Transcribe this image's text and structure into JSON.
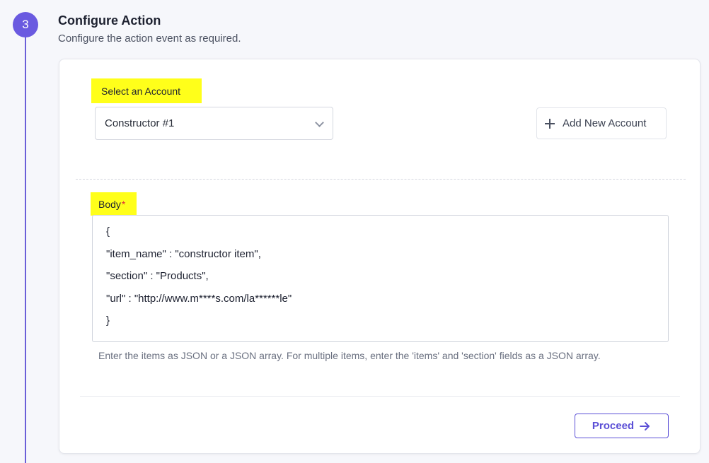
{
  "step": {
    "number": "3",
    "title": "Configure Action",
    "subtitle": "Configure the action event as required."
  },
  "account": {
    "label": "Select an Account",
    "selected": "Constructor #1",
    "add_button_label": "Add New Account"
  },
  "body": {
    "label": "Body",
    "required_marker": "*",
    "lines": [
      "{",
      "\"item_name\" : \"constructor item\",",
      "\"section\" : \"Products\",",
      "\"url\" : \"http://www.m****s.com/la******le\"",
      "}"
    ],
    "help_text": "Enter the items as JSON or a JSON array. For multiple items, enter the 'items' and 'section' fields as a JSON array."
  },
  "actions": {
    "proceed_label": "Proceed"
  },
  "icons": {
    "dropdown": "chevron-down-icon",
    "add": "plus-icon",
    "proceed": "arrow-right-icon"
  },
  "colors": {
    "accent": "#6a5ae0",
    "highlight": "#ffff1a",
    "required": "#e0303a"
  }
}
